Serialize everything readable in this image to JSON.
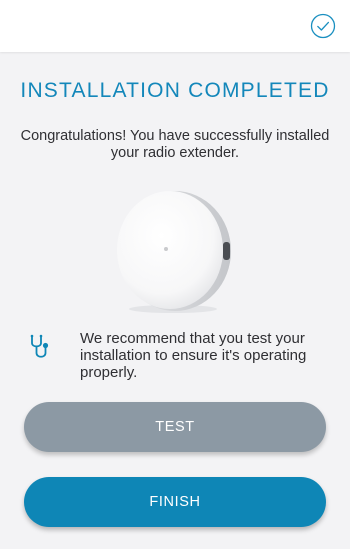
{
  "header": {
    "confirm_icon": "check-circle-icon",
    "accent_color": "#1387ba"
  },
  "main": {
    "title": "INSTALLATION COMPLETED",
    "subtitle": "Congratulations! You have successfully installed your radio extender.",
    "device_image": "radio-extender-device",
    "recommendation_icon": "stethoscope-icon",
    "recommendation_text": "We recommend that you test your installation to ensure it's operating properly."
  },
  "buttons": {
    "test_label": "TEST",
    "test_color": "#8c99a4",
    "finish_label": "FINISH",
    "finish_color": "#0e86b6"
  }
}
